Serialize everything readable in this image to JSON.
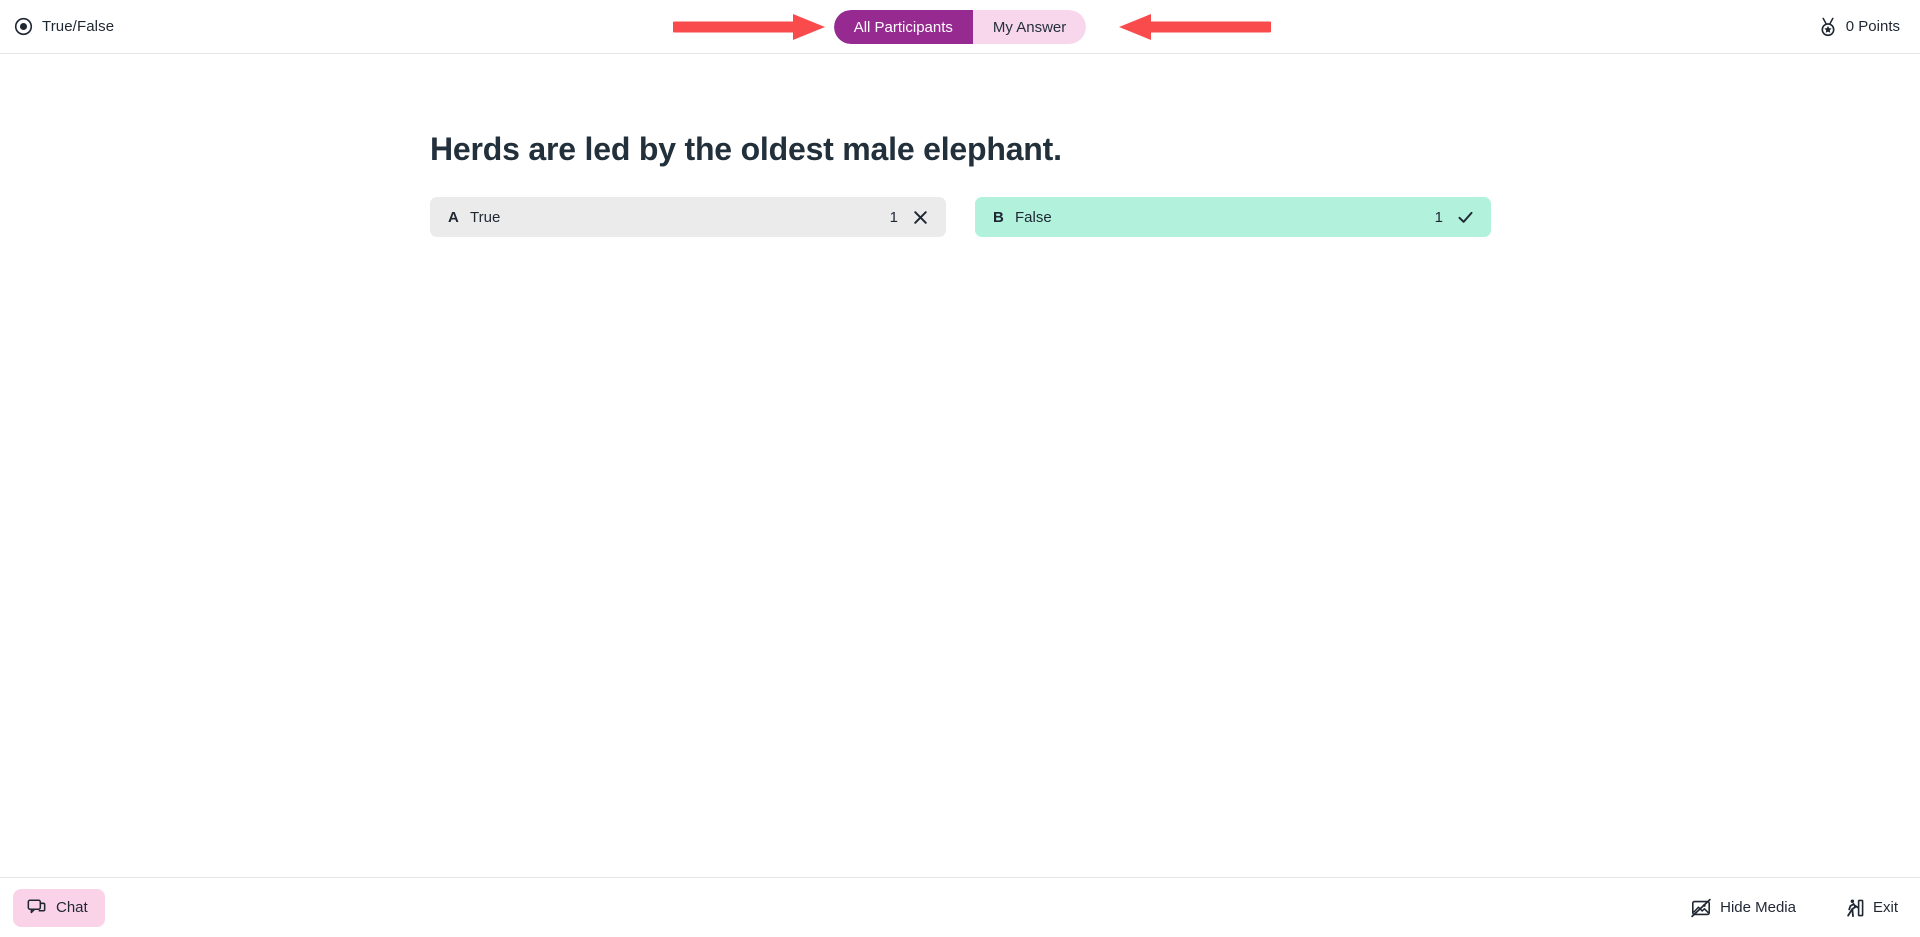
{
  "header": {
    "question_type_icon": "radio-circle-icon",
    "question_type": "True/False",
    "toggle": {
      "all_participants_label": "All Participants",
      "my_answer_label": "My Answer",
      "active": "All Participants",
      "active_bg": "#962a90",
      "inactive_bg": "#f8d7ec"
    },
    "points_icon": "medal-icon",
    "points": "0 Points"
  },
  "annotations": {
    "color": "#f94b4b",
    "left_arrow": "arrow-pointing-right-to-all-participants",
    "right_arrow": "arrow-pointing-left-to-my-answer"
  },
  "main": {
    "question": "Herds are led by the oldest male elephant.",
    "options": [
      {
        "letter": "A",
        "text": "True",
        "count": "1",
        "state": "incorrect",
        "mark_icon": "x-icon",
        "bg": "#ebebeb"
      },
      {
        "letter": "B",
        "text": "False",
        "count": "1",
        "state": "correct",
        "mark_icon": "check-icon",
        "bg": "#b2f2dd"
      }
    ]
  },
  "footer": {
    "chat_icon": "chat-bubbles-icon",
    "chat_label": "Chat",
    "chat_bg": "#fbd3e8",
    "hide_media_icon": "image-slash-icon",
    "hide_media_label": "Hide Media",
    "exit_icon": "exit-door-icon",
    "exit_label": "Exit"
  }
}
